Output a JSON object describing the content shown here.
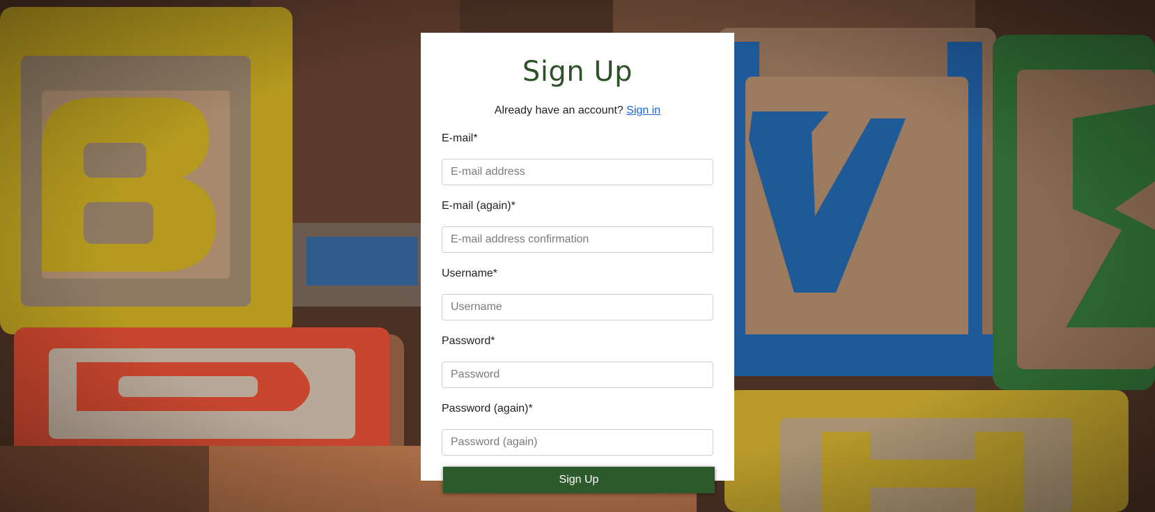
{
  "form": {
    "title": "Sign Up",
    "signin_prompt": "Already have an account?",
    "signin_link": "Sign in",
    "fields": [
      {
        "label": "E-mail*",
        "placeholder": "E-mail address"
      },
      {
        "label": "E-mail (again)*",
        "placeholder": "E-mail address confirmation"
      },
      {
        "label": "Username*",
        "placeholder": "Username"
      },
      {
        "label": "Password*",
        "placeholder": "Password"
      },
      {
        "label": "Password (again)*",
        "placeholder": "Password (again)"
      }
    ],
    "submit_label": "Sign Up"
  },
  "colors": {
    "title": "#2d5227",
    "button": "#2d5a2c",
    "link": "#1565d8"
  }
}
